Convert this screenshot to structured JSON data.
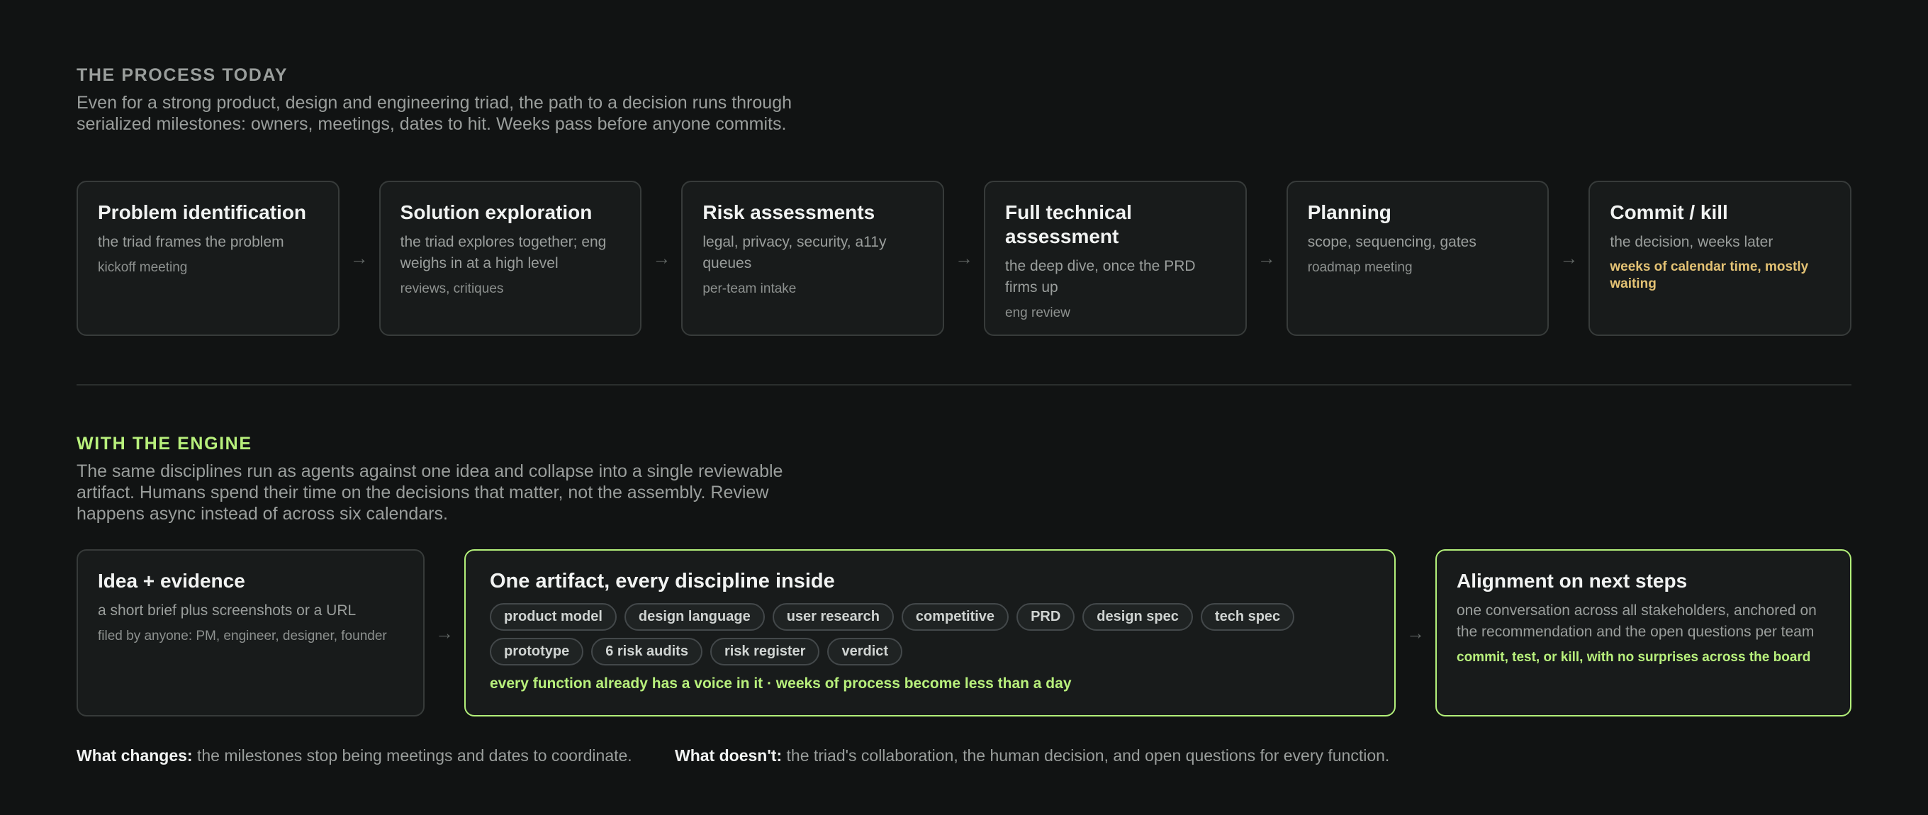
{
  "today": {
    "title": "THE PROCESS TODAY",
    "title_color": "#9a9e9c",
    "description": "Even for a strong product, design and engineering triad, the path to a decision runs through serialized milestones: owners, meetings, dates to hit. Weeks pass before anyone commits.",
    "steps": [
      {
        "title": "Problem identification",
        "desc": "the triad frames the problem",
        "meta": "kickoff meeting"
      },
      {
        "title": "Solution exploration",
        "desc": "the triad explores together; eng weighs in at a high level",
        "meta": "reviews, critiques"
      },
      {
        "title": "Risk assessments",
        "desc": "legal, privacy, security, a11y queues",
        "meta": "per-team intake"
      },
      {
        "title": "Full technical assessment",
        "desc": "the deep dive, once the PRD firms up",
        "meta": "eng review"
      },
      {
        "title": "Planning",
        "desc": "scope, sequencing, gates",
        "meta": "roadmap meeting"
      },
      {
        "title": "Commit / kill",
        "desc": "the decision, weeks later",
        "meta": "weeks of calendar time, mostly waiting",
        "meta_color": "#e3c274"
      }
    ]
  },
  "engine": {
    "title": "WITH THE ENGINE",
    "title_color": "#b8f07c",
    "description": "The same disciplines run as agents against one idea and collapse into a single reviewable artifact. Humans spend their time on the decisions that matter, not the assembly. Review happens async instead of across six calendars.",
    "input": {
      "title": "Idea + evidence",
      "desc": "a short brief plus screenshots or a URL",
      "meta": "filed by anyone: PM, engineer, designer, founder"
    },
    "artifact": {
      "title": "One artifact, every discipline inside",
      "chips": [
        "product model",
        "design language",
        "user research",
        "competitive",
        "PRD",
        "design spec",
        "tech spec",
        "prototype",
        "6 risk audits",
        "risk register",
        "verdict"
      ],
      "note": "every function already has a voice in it · weeks of process become less than a day"
    },
    "output": {
      "title": "Alignment on next steps",
      "desc": "one conversation across all stakeholders, anchored on the recommendation and the open questions per team",
      "note": "commit, test, or kill, with no surprises across the board"
    },
    "accent_color": "#b3f07a"
  },
  "footer": {
    "changes_label": "What changes:",
    "changes_text": "the milestones stop being meetings and dates to coordinate.",
    "doesnt_label": "What doesn't:",
    "doesnt_text": "the triad's collaboration, the human decision, and open questions for every function."
  },
  "icons": {
    "arrow": "arrow-right-icon"
  }
}
